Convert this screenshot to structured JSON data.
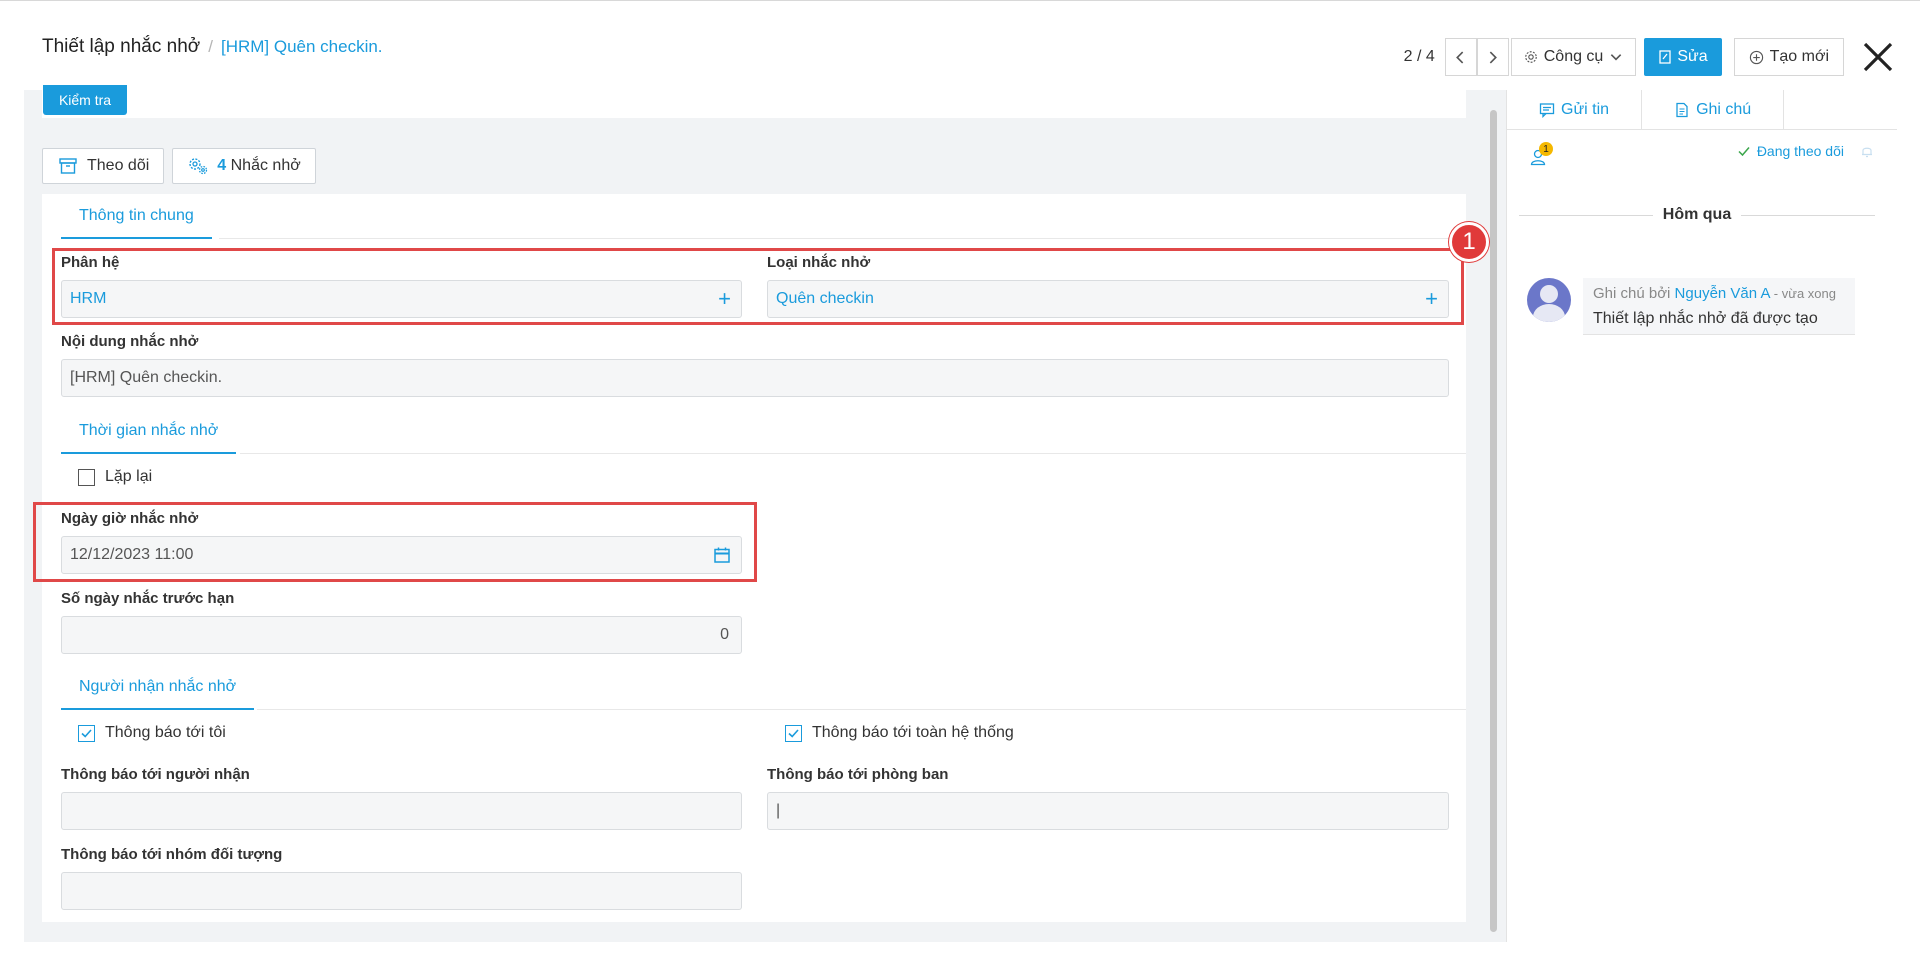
{
  "header": {
    "title": "Thiết lập nhắc nhở",
    "separator": "/",
    "current": "[HRM] Quên checkin.",
    "pager": "2 / 4",
    "tools_label": "Công cụ",
    "edit_label": "Sửa",
    "new_label": "Tạo mới"
  },
  "top": {
    "check_label": "Kiểm tra",
    "follow_label": "Theo dõi",
    "reminder_count": "4",
    "reminder_label": "Nhắc nhở"
  },
  "general": {
    "tab": "Thông tin chung",
    "module_label": "Phân hệ",
    "module_value": "HRM",
    "type_label": "Loại nhắc nhở",
    "type_value": "Quên checkin",
    "content_label": "Nội dung nhắc nhở",
    "content_value": "[HRM] Quên checkin."
  },
  "time": {
    "tab": "Thời gian nhắc nhở",
    "repeat_label": "Lặp lại",
    "repeat_checked": false,
    "datetime_label": "Ngày giờ nhắc nhở",
    "datetime_value": "12/12/2023 11:00",
    "days_before_label": "Số ngày nhắc trước hạn",
    "days_before_value": "0"
  },
  "recipients": {
    "tab": "Người nhận nhắc nhở",
    "notify_me_label": "Thông báo tới tôi",
    "notify_me_checked": true,
    "notify_all_label": "Thông báo tới toàn hệ thống",
    "notify_all_checked": true,
    "to_users_label": "Thông báo tới người nhận",
    "to_users_value": "",
    "to_departments_label": "Thông báo tới phòng ban",
    "to_departments_value": "|",
    "to_groups_label": "Thông báo tới nhóm đối tượng",
    "to_groups_value": ""
  },
  "annotation": {
    "badge": "1"
  },
  "chatter": {
    "send_tab": "Gửi tin",
    "note_tab": "Ghi chú",
    "follower_count": "1",
    "following_label": "Đang theo dõi",
    "day_label": "Hôm qua",
    "message": {
      "prefix": "Ghi chú bởi",
      "author": "Nguyễn Văn A",
      "when": "- vừa xong",
      "body": "Thiết lập nhắc nhở đã được tạo"
    }
  },
  "colors": {
    "accent": "#1a9bdc",
    "highlight_border": "#e04848",
    "follower_badge": "#f5b800"
  }
}
